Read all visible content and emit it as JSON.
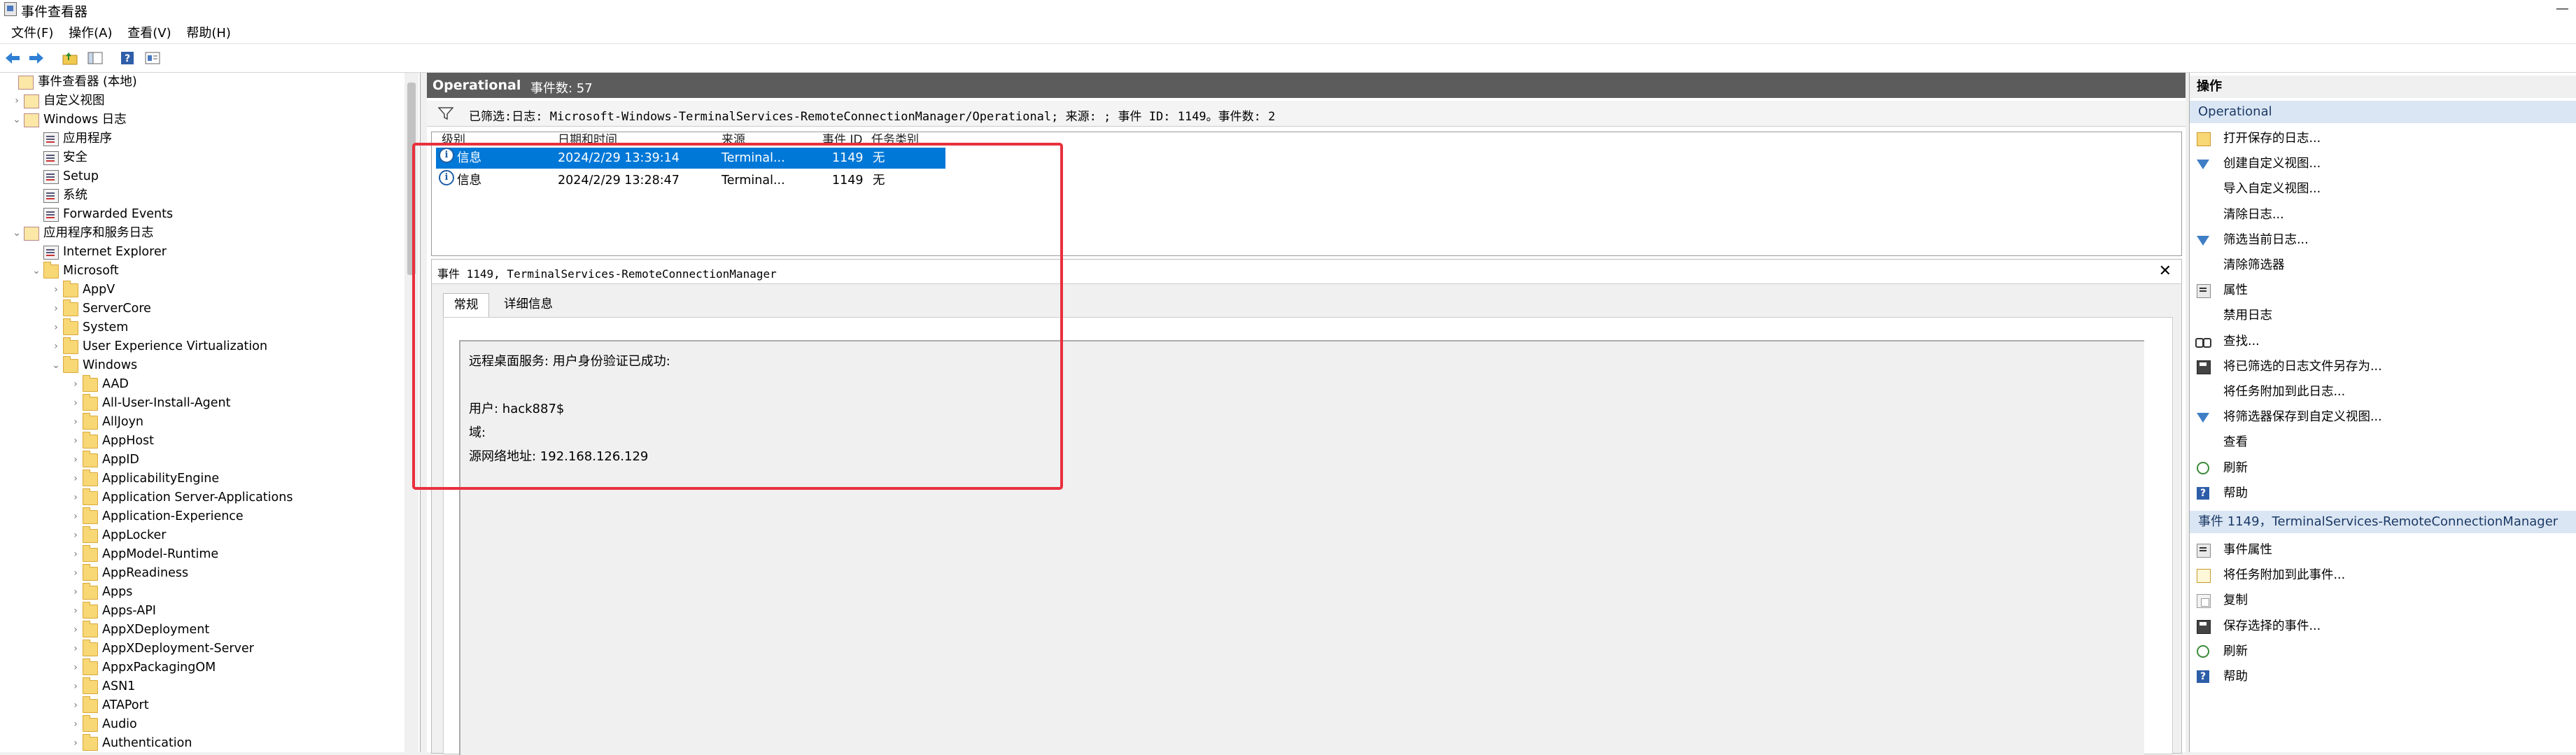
{
  "window": {
    "title": "事件查看器",
    "minimize_symbol": "—"
  },
  "menu": [
    "文件(F)",
    "操作(A)",
    "查看(V)",
    "帮助(H)"
  ],
  "toolbar_icons": [
    "back-arrow-icon",
    "forward-arrow-icon",
    "up-folder-icon",
    "show-hide-tree-icon",
    "help-icon",
    "properties-icon"
  ],
  "tree": [
    {
      "label": "事件查看器 (本地)",
      "level": 0,
      "twisty": "",
      "icon": "viewer"
    },
    {
      "label": "自定义视图",
      "level": 1,
      "twisty": "›",
      "icon": "view"
    },
    {
      "label": "Windows 日志",
      "level": 1,
      "twisty": "⌄",
      "icon": "view"
    },
    {
      "label": "应用程序",
      "level": 2,
      "twisty": "",
      "icon": "log"
    },
    {
      "label": "安全",
      "level": 2,
      "twisty": "",
      "icon": "log"
    },
    {
      "label": "Setup",
      "level": 2,
      "twisty": "",
      "icon": "log"
    },
    {
      "label": "系统",
      "level": 2,
      "twisty": "",
      "icon": "log"
    },
    {
      "label": "Forwarded Events",
      "level": 2,
      "twisty": "",
      "icon": "log"
    },
    {
      "label": "应用程序和服务日志",
      "level": 1,
      "twisty": "⌄",
      "icon": "view"
    },
    {
      "label": "Internet Explorer",
      "level": 2,
      "twisty": "",
      "icon": "log"
    },
    {
      "label": "Microsoft",
      "level": 2,
      "twisty": "⌄",
      "icon": "folder"
    },
    {
      "label": "AppV",
      "level": 3,
      "twisty": "›",
      "icon": "folder"
    },
    {
      "label": "ServerCore",
      "level": 3,
      "twisty": "›",
      "icon": "folder"
    },
    {
      "label": "System",
      "level": 3,
      "twisty": "›",
      "icon": "folder"
    },
    {
      "label": "User Experience Virtualization",
      "level": 3,
      "twisty": "›",
      "icon": "folder"
    },
    {
      "label": "Windows",
      "level": 3,
      "twisty": "⌄",
      "icon": "folder"
    },
    {
      "label": "AAD",
      "level": 4,
      "twisty": "›",
      "icon": "folder"
    },
    {
      "label": "All-User-Install-Agent",
      "level": 4,
      "twisty": "›",
      "icon": "folder"
    },
    {
      "label": "AllJoyn",
      "level": 4,
      "twisty": "›",
      "icon": "folder"
    },
    {
      "label": "AppHost",
      "level": 4,
      "twisty": "›",
      "icon": "folder"
    },
    {
      "label": "AppID",
      "level": 4,
      "twisty": "›",
      "icon": "folder"
    },
    {
      "label": "ApplicabilityEngine",
      "level": 4,
      "twisty": "›",
      "icon": "folder"
    },
    {
      "label": "Application Server-Applications",
      "level": 4,
      "twisty": "›",
      "icon": "folder"
    },
    {
      "label": "Application-Experience",
      "level": 4,
      "twisty": "›",
      "icon": "folder"
    },
    {
      "label": "AppLocker",
      "level": 4,
      "twisty": "›",
      "icon": "folder"
    },
    {
      "label": "AppModel-Runtime",
      "level": 4,
      "twisty": "›",
      "icon": "folder"
    },
    {
      "label": "AppReadiness",
      "level": 4,
      "twisty": "›",
      "icon": "folder"
    },
    {
      "label": "Apps",
      "level": 4,
      "twisty": "›",
      "icon": "folder"
    },
    {
      "label": "Apps-API",
      "level": 4,
      "twisty": "›",
      "icon": "folder"
    },
    {
      "label": "AppXDeployment",
      "level": 4,
      "twisty": "›",
      "icon": "folder"
    },
    {
      "label": "AppXDeployment-Server",
      "level": 4,
      "twisty": "›",
      "icon": "folder"
    },
    {
      "label": "AppxPackagingOM",
      "level": 4,
      "twisty": "›",
      "icon": "folder"
    },
    {
      "label": "ASN1",
      "level": 4,
      "twisty": "›",
      "icon": "folder"
    },
    {
      "label": "ATAPort",
      "level": 4,
      "twisty": "›",
      "icon": "folder"
    },
    {
      "label": "Audio",
      "level": 4,
      "twisty": "›",
      "icon": "folder"
    },
    {
      "label": "Authentication",
      "level": 4,
      "twisty": "›",
      "icon": "folder"
    }
  ],
  "center": {
    "header_title": "Operational",
    "header_count": "事件数: 57",
    "filter_text": "已筛选:日志: Microsoft-Windows-TerminalServices-RemoteConnectionManager/Operational; 来源: ; 事件 ID: 1149。事件数: 2",
    "columns": [
      "级别",
      "日期和时间",
      "来源",
      "事件 ID",
      "任务类别"
    ],
    "rows": [
      {
        "level": "信息",
        "datetime": "2024/2/29 13:39:14",
        "source": "Terminal...",
        "event_id": "1149",
        "task": "无",
        "selected": true
      },
      {
        "level": "信息",
        "datetime": "2024/2/29 13:28:47",
        "source": "Terminal...",
        "event_id": "1149",
        "task": "无",
        "selected": false
      }
    ],
    "detail_title": "事件 1149, TerminalServices-RemoteConnectionManager",
    "close_symbol": "✕",
    "tabs": [
      "常规",
      "详细信息"
    ],
    "detail_lines": [
      "远程桌面服务: 用户身份验证已成功:",
      "",
      "用户: hack887$",
      "域:",
      "源网络地址: 192.168.126.129"
    ]
  },
  "actions": {
    "header": "操作",
    "section1": "Operational",
    "items1": [
      {
        "label": "打开保存的日志...",
        "icon": "open-log-icon"
      },
      {
        "label": "创建自定义视图...",
        "icon": "funnel-icon"
      },
      {
        "label": "导入自定义视图...",
        "icon": ""
      },
      {
        "label": "清除日志...",
        "icon": ""
      },
      {
        "label": "筛选当前日志...",
        "icon": "funnel-icon"
      },
      {
        "label": "清除筛选器",
        "icon": ""
      },
      {
        "label": "属性",
        "icon": "properties-icon"
      },
      {
        "label": "禁用日志",
        "icon": ""
      },
      {
        "label": "查找...",
        "icon": "find-icon"
      },
      {
        "label": "将已筛选的日志文件另存为...",
        "icon": "save-icon"
      },
      {
        "label": "将任务附加到此日志...",
        "icon": ""
      },
      {
        "label": "将筛选器保存到自定义视图...",
        "icon": "funnel-icon"
      },
      {
        "label": "查看",
        "icon": ""
      },
      {
        "label": "刷新",
        "icon": "refresh-icon"
      },
      {
        "label": "帮助",
        "icon": "help-icon"
      }
    ],
    "section2": "事件 1149，TerminalServices-RemoteConnectionManager",
    "items2": [
      {
        "label": "事件属性",
        "icon": "properties-icon"
      },
      {
        "label": "将任务附加到此事件...",
        "icon": "task-icon"
      },
      {
        "label": "复制",
        "icon": "copy-icon"
      },
      {
        "label": "保存选择的事件...",
        "icon": "save-icon"
      },
      {
        "label": "刷新",
        "icon": "refresh-icon"
      },
      {
        "label": "帮助",
        "icon": "help-icon"
      }
    ]
  },
  "colors": {
    "selection": "#0078d7",
    "highlight_box": "#e8303e",
    "header_bar": "#5c5c5c",
    "section_bar": "#dbe6f4"
  }
}
